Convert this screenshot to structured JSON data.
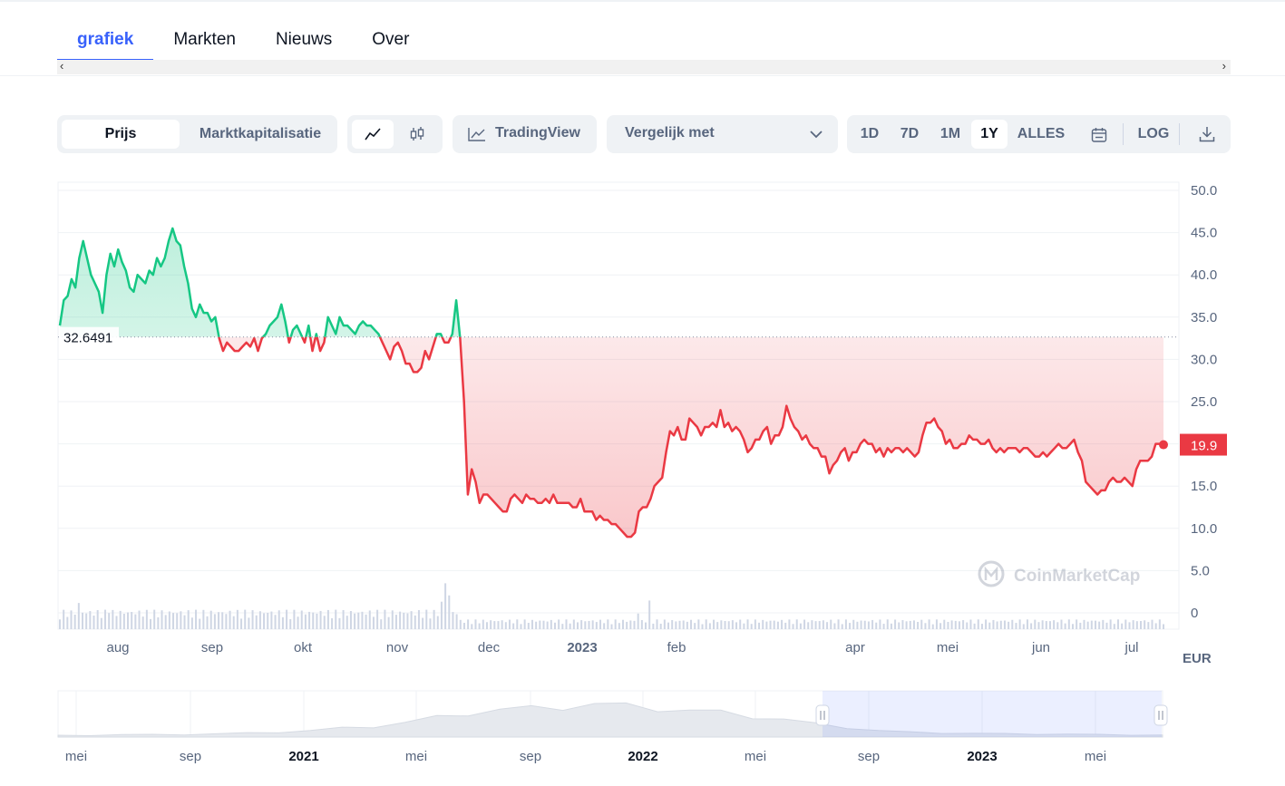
{
  "tabs": [
    "grafiek",
    "Markten",
    "Nieuws",
    "Over"
  ],
  "toolbar": {
    "price_label": "Prijs",
    "marketcap_label": "Marktkapitalisatie",
    "tradingview_label": "TradingView",
    "compare_label": "Vergelijk met",
    "ranges": [
      "1D",
      "7D",
      "1M",
      "1Y",
      "ALLES"
    ],
    "active_range": "1Y",
    "log_label": "LOG"
  },
  "colors": {
    "accent": "#3861fb",
    "up": "#16c784",
    "down": "#ea3943"
  },
  "watermark": "CoinMarketCap",
  "currency": "EUR",
  "chart_data": {
    "type": "line",
    "y_ticks": [
      "50.0",
      "45.0",
      "40.0",
      "35.0",
      "30.0",
      "25.0",
      "20.0",
      "15.0",
      "10.0",
      "5.0",
      "0"
    ],
    "ylim": [
      0,
      50
    ],
    "x_tick_labels": [
      "aug",
      "sep",
      "okt",
      "nov",
      "dec",
      "2023",
      "feb",
      "apr",
      "mei",
      "jun",
      "jul"
    ],
    "reference_value": "32.6491",
    "last_value": "19.9",
    "series": [
      {
        "values": [
          34.0,
          37.0,
          37.5,
          39.5,
          38.5,
          42.0,
          44.0,
          42.0,
          40.0,
          39.0,
          38.0,
          35.5,
          40.0,
          42.5,
          41.0,
          43.0,
          41.5,
          40.5,
          38.5,
          38.0,
          40.0,
          39.5,
          39.0,
          40.5,
          40.0,
          42.0,
          41.0,
          42.0,
          44.0,
          45.5,
          44.0,
          43.5,
          41.0,
          39.0,
          36.0,
          35.0,
          36.5,
          35.5,
          35.5,
          34.5,
          35.0,
          32.5,
          31.0,
          32.0,
          31.5,
          31.0,
          31.0,
          31.5,
          32.0,
          31.5,
          32.5,
          31.0,
          32.5,
          33.0,
          34.0,
          34.5,
          35.0,
          36.5,
          34.5,
          32.0,
          33.5,
          34.0,
          33.0,
          32.0,
          34.0,
          31.0,
          33.0,
          31.0,
          32.0,
          35.0,
          34.0,
          33.0,
          35.0,
          34.0,
          34.0,
          33.5,
          33.0,
          34.0,
          34.5,
          34.0,
          34.0,
          33.5,
          33.0,
          32.0,
          31.0,
          30.0,
          31.5,
          32.0,
          31.0,
          29.5,
          29.5,
          28.5,
          28.5,
          29.0,
          31.0,
          30.0,
          31.5,
          33.0,
          33.0,
          32.0,
          32.0,
          33.0,
          37.0,
          32.5,
          25.0,
          14.0,
          17.0,
          15.5,
          13.0,
          14.0,
          14.0,
          13.5,
          13.0,
          12.5,
          12.0,
          12.0,
          13.5,
          14.0,
          13.5,
          13.0,
          14.0,
          13.5,
          13.5,
          13.0,
          13.0,
          13.5,
          13.0,
          14.0,
          13.0,
          13.0,
          13.0,
          13.0,
          12.5,
          12.5,
          13.5,
          12.0,
          12.0,
          12.0,
          11.0,
          11.5,
          11.0,
          11.0,
          10.5,
          10.5,
          10.0,
          9.5,
          9.0,
          9.0,
          9.5,
          12.0,
          12.5,
          12.5,
          13.5,
          15.0,
          15.5,
          16.0,
          19.0,
          21.5,
          21.0,
          22.0,
          20.5,
          20.5,
          23.0,
          22.5,
          22.0,
          21.0,
          22.0,
          22.0,
          22.5,
          22.0,
          24.0,
          22.0,
          22.5,
          21.5,
          22.0,
          21.5,
          20.5,
          19.0,
          19.5,
          20.5,
          20.5,
          21.5,
          22.0,
          20.0,
          21.0,
          21.0,
          22.0,
          24.5,
          23.0,
          22.0,
          21.5,
          20.5,
          21.0,
          20.0,
          19.5,
          19.5,
          18.5,
          18.5,
          16.5,
          17.5,
          18.0,
          19.0,
          19.5,
          18.0,
          19.0,
          19.0,
          20.0,
          20.5,
          20.0,
          20.0,
          19.0,
          19.5,
          18.5,
          19.5,
          19.0,
          19.5,
          19.5,
          19.0,
          19.5,
          19.0,
          18.5,
          19.0,
          21.0,
          22.5,
          22.5,
          23.0,
          22.0,
          21.5,
          20.0,
          20.5,
          19.5,
          19.5,
          20.0,
          20.0,
          21.0,
          20.5,
          20.5,
          20.0,
          20.0,
          20.5,
          19.5,
          19.0,
          19.5,
          19.0,
          19.5,
          19.5,
          19.5,
          19.0,
          19.5,
          19.5,
          19.0,
          18.5,
          18.5,
          19.0,
          18.5,
          19.0,
          19.5,
          20.0,
          19.5,
          19.5,
          20.0,
          20.5,
          19.0,
          18.0,
          15.5,
          15.0,
          14.5,
          14.0,
          14.5,
          14.5,
          15.5,
          16.0,
          15.5,
          15.5,
          16.0,
          15.5,
          15.0,
          17.0,
          18.0,
          18.0,
          18.0,
          18.5,
          20.0,
          20.0,
          19.9
        ]
      }
    ],
    "volumes": [
      2,
      2,
      2,
      2,
      2,
      3,
      2,
      2,
      2,
      2,
      2,
      2,
      2,
      3,
      2,
      2,
      2,
      2,
      2,
      2,
      2,
      2,
      2,
      2,
      2,
      2,
      2,
      2,
      2,
      2,
      2,
      2,
      2,
      2,
      2,
      2,
      2,
      2,
      2,
      2,
      2,
      2,
      2,
      2,
      2,
      2,
      2,
      2,
      2,
      2,
      2,
      2,
      2,
      2,
      2,
      2,
      2,
      2,
      2,
      2,
      2,
      2,
      2,
      2,
      2,
      2,
      2,
      2,
      2,
      2,
      2,
      2,
      2,
      2,
      2,
      2,
      2,
      2,
      2,
      2,
      2,
      2,
      2,
      2,
      2,
      2,
      2,
      2,
      2,
      2,
      2,
      2,
      2,
      2,
      2,
      2,
      2,
      2,
      2,
      2,
      2,
      3,
      6,
      4,
      2,
      2,
      1,
      1,
      1,
      1,
      1,
      1,
      1,
      1,
      1,
      1,
      1,
      1,
      1,
      1,
      1,
      1,
      1,
      1,
      1,
      1,
      1,
      1,
      1,
      1,
      1,
      1,
      1,
      1,
      1,
      1,
      1,
      1,
      1,
      1,
      1,
      1,
      1,
      1,
      1,
      1,
      1,
      1,
      1,
      1,
      1,
      1,
      1,
      2,
      1,
      1,
      3,
      1,
      1,
      1,
      1,
      1,
      1,
      1,
      1,
      1,
      1,
      1,
      1,
      1,
      1,
      1,
      1,
      1,
      1,
      1,
      1,
      1,
      1,
      1,
      1,
      1,
      1,
      1,
      1,
      1,
      1,
      1,
      1,
      1,
      1,
      1,
      1,
      1,
      1,
      1,
      1,
      1,
      1,
      1,
      1,
      1,
      1,
      1,
      1,
      1,
      1,
      1,
      1,
      1,
      1,
      1,
      1,
      1,
      1,
      1,
      1,
      1,
      1,
      1,
      1,
      1,
      1,
      1,
      1,
      1,
      1,
      1,
      1,
      1,
      1,
      1,
      1,
      1,
      1,
      1,
      1,
      1,
      1,
      1,
      1,
      1,
      1,
      1,
      1,
      1,
      1,
      1,
      1,
      1,
      1,
      1,
      1,
      1,
      1,
      1,
      1,
      1,
      1,
      1,
      1,
      1,
      1,
      1,
      1,
      1,
      1,
      1,
      1,
      1,
      1,
      1,
      1,
      1,
      1,
      1,
      1,
      1,
      1,
      1,
      1,
      1,
      1,
      1,
      1,
      1,
      1,
      1,
      1,
      1,
      1,
      1,
      1
    ]
  },
  "navigator": {
    "labels": [
      "mei",
      "sep",
      "2021",
      "mei",
      "sep",
      "2022",
      "mei",
      "sep",
      "2023",
      "mei"
    ],
    "bold": [
      false,
      false,
      true,
      false,
      false,
      true,
      false,
      false,
      true,
      false
    ],
    "values": [
      0.2,
      0.2,
      0.3,
      0.3,
      0.3,
      0.4,
      0.5,
      0.6,
      0.8,
      1.1,
      1.3,
      1.8,
      2.4,
      3.0,
      3.4,
      3.5,
      3.8,
      4.1,
      3.8,
      3.6,
      3.3,
      3.0,
      2.6,
      2.2,
      1.6,
      1.2,
      0.8,
      0.6,
      0.5,
      0.45,
      0.4,
      0.35,
      0.35,
      0.3,
      0.25,
      0.25
    ]
  }
}
